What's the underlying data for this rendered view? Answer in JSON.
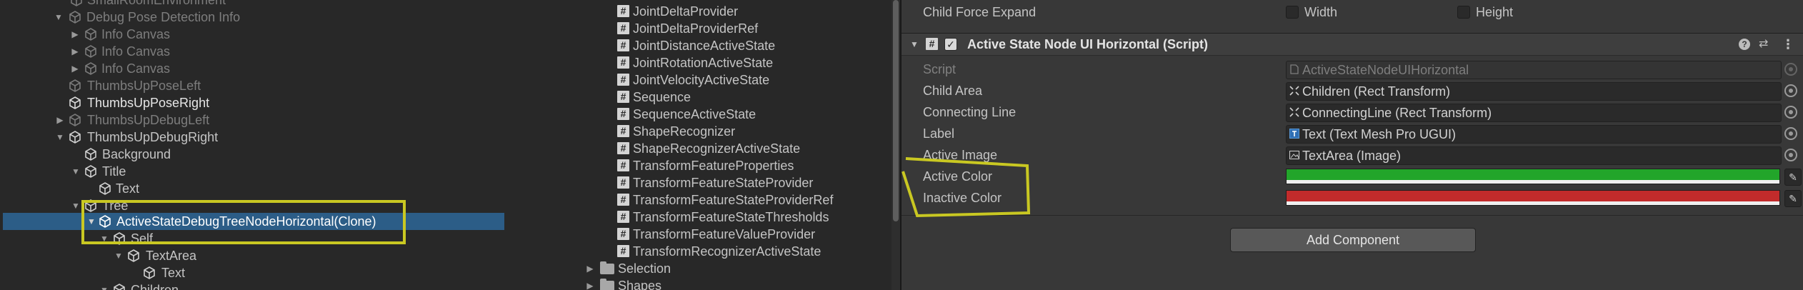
{
  "hierarchy": {
    "items": [
      {
        "label": "SmallRoomEnvironment",
        "state": "dim"
      },
      {
        "label": "Debug Pose Detection Info",
        "state": "dim"
      },
      {
        "label": "Info Canvas",
        "state": "dim"
      },
      {
        "label": "Info Canvas",
        "state": "dim"
      },
      {
        "label": "Info Canvas",
        "state": "dim"
      },
      {
        "label": "ThumbsUpPoseLeft",
        "state": "dim"
      },
      {
        "label": "ThumbsUpPoseRight",
        "state": "bright"
      },
      {
        "label": "ThumbsUpDebugLeft",
        "state": "dim"
      },
      {
        "label": "ThumbsUpDebugRight",
        "state": "normal"
      },
      {
        "label": "Background",
        "state": "normal"
      },
      {
        "label": "Title",
        "state": "normal"
      },
      {
        "label": "Text",
        "state": "normal"
      },
      {
        "label": "Tree",
        "state": "normal"
      },
      {
        "label": "ActiveStateDebugTreeNodeHorizontal(Clone)",
        "state": "selected"
      },
      {
        "label": "Self",
        "state": "normal"
      },
      {
        "label": "TextArea",
        "state": "normal"
      },
      {
        "label": "Text",
        "state": "normal"
      },
      {
        "label": "Children",
        "state": "normal"
      }
    ]
  },
  "project": {
    "scripts": [
      "JointDeltaProvider",
      "JointDeltaProviderRef",
      "JointDistanceActiveState",
      "JointRotationActiveState",
      "JointVelocityActiveState",
      "Sequence",
      "SequenceActiveState",
      "ShapeRecognizer",
      "ShapeRecognizerActiveState",
      "TransformFeatureProperties",
      "TransformFeatureStateProvider",
      "TransformFeatureStateProviderRef",
      "TransformFeatureStateThresholds",
      "TransformFeatureValueProvider",
      "TransformRecognizerActiveState"
    ],
    "folders": [
      "Selection",
      "Shapes"
    ]
  },
  "inspector": {
    "child_force_expand": {
      "label": "Child Force Expand",
      "width_label": "Width",
      "height_label": "Height"
    },
    "component": {
      "title": "Active State Node UI Horizontal (Script)",
      "icons": [
        "help-icon",
        "preset-icon",
        "more-icon"
      ],
      "properties": [
        {
          "label": "Script",
          "value": "ActiveStateNodeUIHorizontal",
          "icon": "script-icon",
          "readonly": true
        },
        {
          "label": "Child Area",
          "value": "Children (Rect Transform)",
          "icon": "rect-transform-icon"
        },
        {
          "label": "Connecting Line",
          "value": "ConnectingLine (Rect Transform)",
          "icon": "rect-transform-icon"
        },
        {
          "label": "Label",
          "value": "Text (Text Mesh Pro UGUI)",
          "icon": "text-mesh-pro-icon"
        },
        {
          "label": "Active Image",
          "value": "TextArea (Image)",
          "icon": "image-icon"
        }
      ],
      "colors": [
        {
          "label": "Active Color",
          "value": "#22a52a"
        },
        {
          "label": "Inactive Color",
          "value": "#c22b2b"
        }
      ]
    },
    "add_component_label": "Add Component"
  },
  "theme": {
    "selection": "#2c5d87",
    "highlight": "#c9c822"
  }
}
